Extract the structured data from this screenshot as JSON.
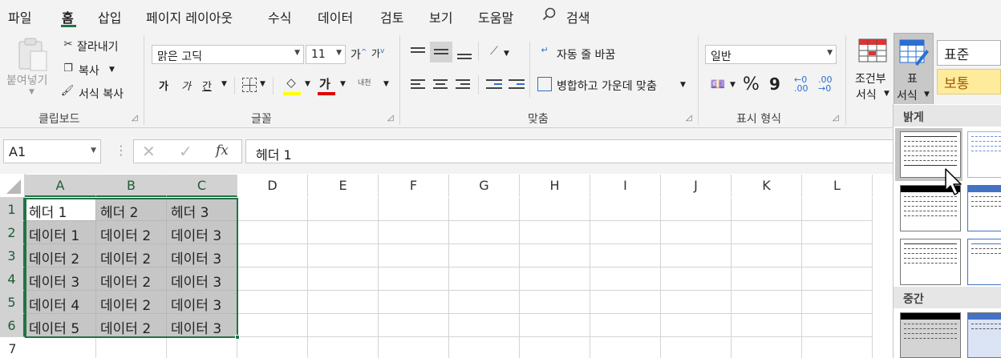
{
  "tabs": [
    "파일",
    "홈",
    "삽입",
    "페이지 레이아웃",
    "수식",
    "데이터",
    "검토",
    "보기",
    "도움말",
    "검색"
  ],
  "clipboard": {
    "paste_label": "붙여넣기",
    "cut_label": "잘라내기",
    "copy_label": "복사",
    "format_painter_label": "서식 복사",
    "group_label": "클립보드"
  },
  "font": {
    "font_name": "맑은 고딕",
    "font_size": "11",
    "grow_label": "가",
    "shrink_label": "가",
    "bold_label": "가",
    "italic_label": "가",
    "underline_label": "간",
    "font_color_label": "가",
    "phonetic_label": "내천",
    "group_label": "글꼴"
  },
  "alignment": {
    "wrap_text_label": "자동 줄 바꿈",
    "merge_center_label": "병합하고 가운데 맞춤",
    "group_label": "맞춤"
  },
  "number": {
    "format": "일반",
    "percent_label": "%",
    "comma_label": "9",
    "inc_decimal_label": "←0\n.00",
    "dec_decimal_label": ".00\n→0",
    "group_label": "표시 형식"
  },
  "styles": {
    "conditional_label_1": "조건부",
    "conditional_label_2": "서식",
    "table_format_label_1": "표",
    "table_format_label_2": "서식",
    "style_normal": "표준",
    "style_neutral": "보통"
  },
  "namebox": "A1",
  "formula_value": "헤더 1",
  "columns": [
    "A",
    "B",
    "C",
    "D",
    "E",
    "F",
    "G",
    "H",
    "I",
    "J",
    "K",
    "L"
  ],
  "rows": [
    "1",
    "2",
    "3",
    "4",
    "5",
    "6",
    "7"
  ],
  "cells": [
    [
      "헤더 1",
      "헤더 2",
      "헤더 3"
    ],
    [
      "데이터 1",
      "데이터 2",
      "데이터 3"
    ],
    [
      "데이터 2",
      "데이터 2",
      "데이터 3"
    ],
    [
      "데이터 3",
      "데이터 2",
      "데이터 3"
    ],
    [
      "데이터 4",
      "데이터 2",
      "데이터 3"
    ],
    [
      "데이터 5",
      "데이터 2",
      "데이터 3"
    ]
  ],
  "gallery": {
    "light_label": "밝게",
    "medium_label": "중간"
  },
  "colors": {
    "accent": "#217346",
    "neutral_style_bg": "#ffeb9c",
    "neutral_style_text": "#9c5700",
    "font_color_bar": "#e00000",
    "highlight_bar": "#ffff00",
    "table_blue": "#4472c4"
  }
}
